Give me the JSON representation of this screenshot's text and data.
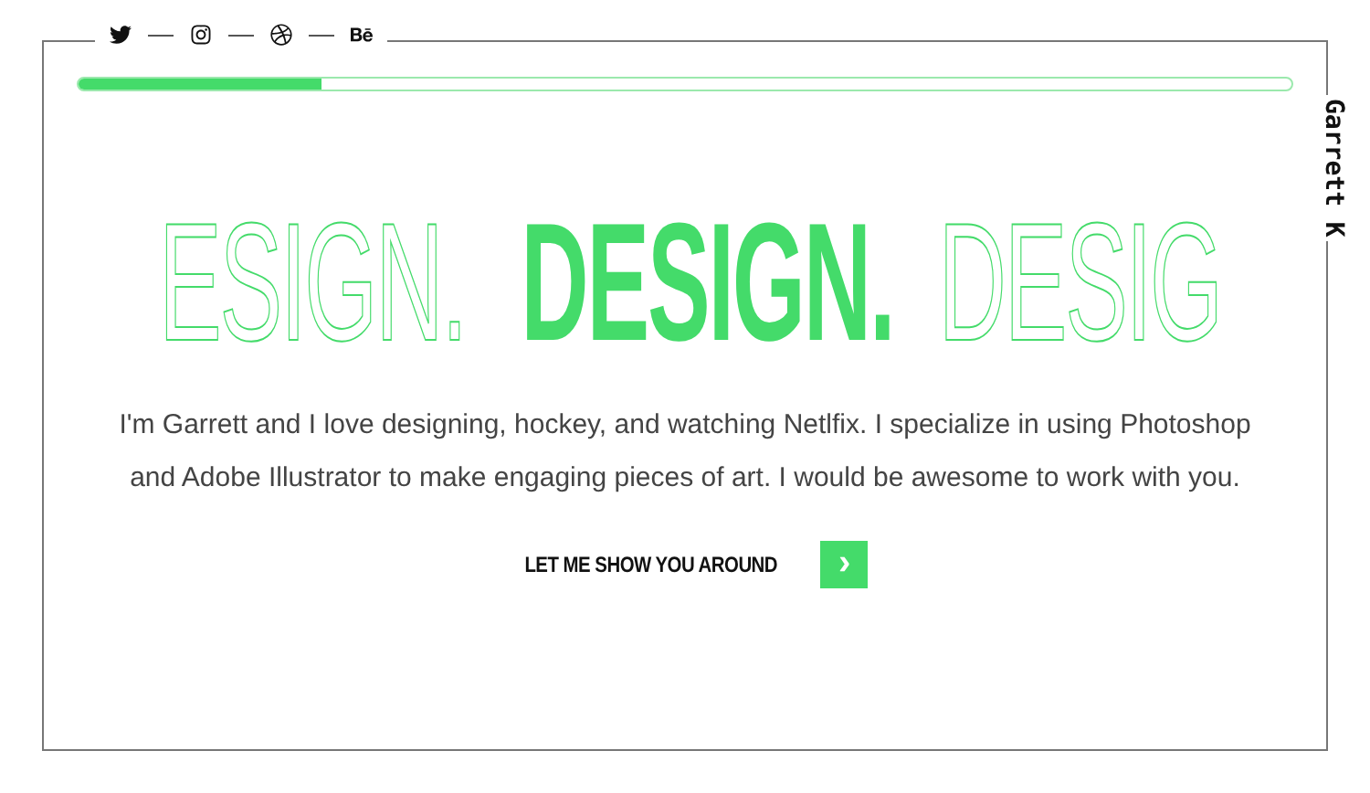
{
  "social_links": [
    {
      "kind": "twitter"
    },
    {
      "kind": "instagram"
    },
    {
      "kind": "dribbble"
    },
    {
      "kind": "behance"
    }
  ],
  "progress": {
    "level": 0.2
  },
  "name": "Garrett K",
  "headline": [
    {
      "text": "ESIGN.",
      "kind": "outline"
    },
    {
      "text": "DESIGN.",
      "kind": "solid"
    },
    {
      "text": "DESIG",
      "kind": "outline"
    }
  ],
  "intro": "I'm Garrett and I love designing, hockey, and watching Netlfix. I specialize in using Photoshop and Adobe Illustrator to make engaging pieces of art. I would be awesome to work with you.",
  "cta": {
    "label": "LET ME SHOW YOU AROUND",
    "icon": "›"
  }
}
